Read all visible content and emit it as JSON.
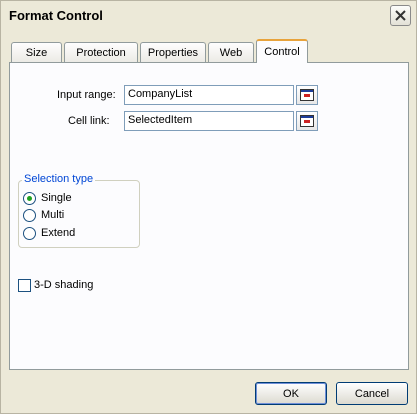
{
  "window": {
    "title": "Format Control"
  },
  "tabs": [
    {
      "label": "Size"
    },
    {
      "label": "Protection"
    },
    {
      "label": "Properties"
    },
    {
      "label": "Web"
    },
    {
      "label": "Control",
      "active": true
    }
  ],
  "control": {
    "input_range": {
      "label": "Input range:",
      "value": "CompanyList"
    },
    "cell_link": {
      "label": "Cell link:",
      "value": "SelectedItem"
    },
    "selection_type": {
      "legend": "Selection type",
      "options": [
        {
          "label": "Single",
          "checked": true
        },
        {
          "label": "Multi",
          "checked": false
        },
        {
          "label": "Extend",
          "checked": false
        }
      ]
    },
    "shading": {
      "label": "3-D shading",
      "checked": false
    }
  },
  "buttons": {
    "ok": "OK",
    "cancel": "Cancel"
  },
  "colors": {
    "accent_tab": "#e8a33b",
    "legend": "#0046d5",
    "radio_dot": "#21a121"
  }
}
